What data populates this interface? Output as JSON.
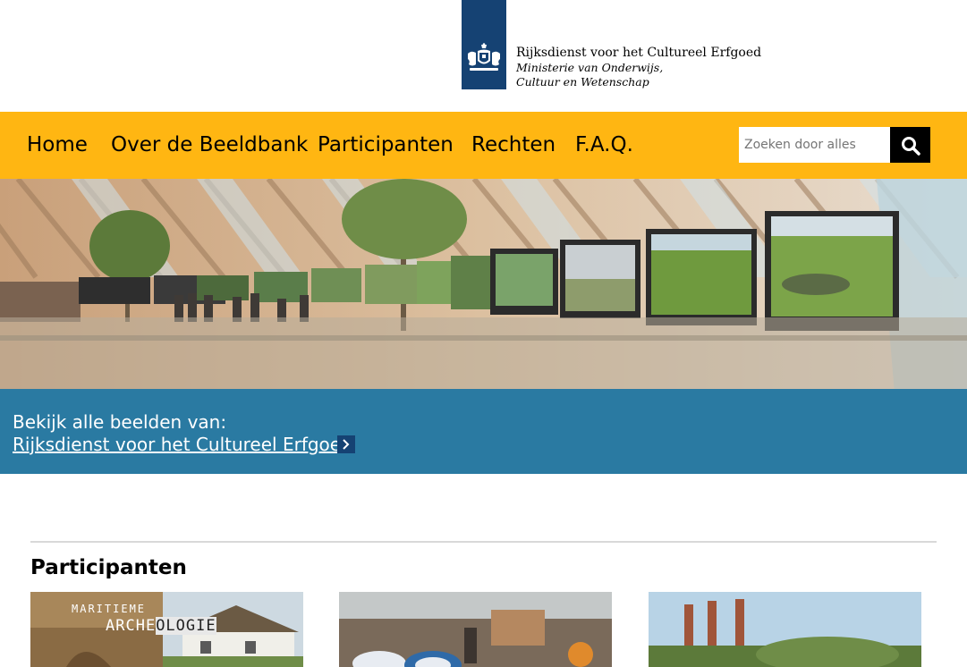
{
  "header": {
    "logo_line1": "Rijksdienst voor het Cultureel Erfgoed",
    "logo_line2": "Ministerie van Onderwijs, Cultuur en Wetenschap",
    "logo_color": "#154273"
  },
  "nav": {
    "items": [
      {
        "label": "Home"
      },
      {
        "label": "Over de Beeldbank"
      },
      {
        "label": "Participanten"
      },
      {
        "label": "Rechten"
      },
      {
        "label": "F.A.Q."
      }
    ],
    "bar_color": "#ffb612"
  },
  "search": {
    "placeholder": "Zoeken door alles",
    "icon": "search-icon"
  },
  "hero": {
    "lead": "Bekijk alle beelden van:",
    "link": "Rijksdienst voor het Cultureel Erfgoed",
    "band_color": "#2177a4",
    "arrow_icon": "chevron-right-icon"
  },
  "participants": {
    "title": "Participanten",
    "cards": [
      {
        "text_line1": "MARITIEME",
        "text_line2a": "ARCHE",
        "text_line2b": "OLOGIE"
      },
      {},
      {}
    ]
  }
}
